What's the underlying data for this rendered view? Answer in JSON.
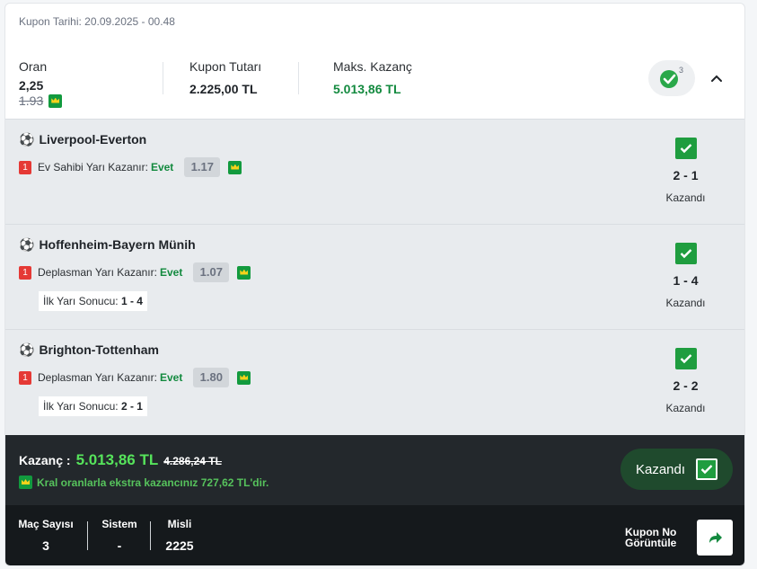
{
  "coupon": {
    "date": "Kupon Tarihi: 20.09.2025 - 00.48"
  },
  "summary": {
    "odds_label": "Oran",
    "odds_value": "2,25",
    "odds_old": "1.93",
    "stake_label": "Kupon Tutarı",
    "stake_value": "2.225,00 TL",
    "max_label": "Maks. Kazanç",
    "max_value": "5.013,86 TL",
    "badge_count": "3"
  },
  "matches": [
    {
      "name": "Liverpool-Everton",
      "rank": "1",
      "market": "Ev Sahibi Yarı Kazanır:",
      "pick": "Evet",
      "odd": "1.17",
      "score": "2 - 1",
      "status": "Kazandı"
    },
    {
      "name": "Hoffenheim-Bayern Münih",
      "rank": "1",
      "market": "Deplasman Yarı Kazanır:",
      "pick": "Evet",
      "odd": "1.07",
      "halftime_label": "İlk Yarı Sonucu:",
      "halftime_value": "1 - 4",
      "score": "1 - 4",
      "status": "Kazandı"
    },
    {
      "name": "Brighton-Tottenham",
      "rank": "1",
      "market": "Deplasman Yarı Kazanır:",
      "pick": "Evet",
      "odd": "1.80",
      "halftime_label": "İlk Yarı Sonucu:",
      "halftime_value": "2 - 1",
      "score": "2 - 2",
      "status": "Kazandı"
    }
  ],
  "footer": {
    "win_label": "Kazanç :",
    "win_amount": "5.013,86 TL",
    "win_old": "4.286,24 TL",
    "extra_text": "Kral oranlarla ekstra kazancınız 727,62 TL'dir.",
    "win_button": "Kazandı"
  },
  "stats": {
    "matches_label": "Maç Sayısı",
    "matches_value": "3",
    "system_label": "Sistem",
    "system_value": "-",
    "multiplier_label": "Misli",
    "multiplier_value": "2225",
    "coupon_view_line1": "Kupon No",
    "coupon_view_line2": "Görüntüle"
  },
  "colors": {
    "accent_green": "#138a3f",
    "win_green": "#56e35b",
    "check_green": "#1f9d3f",
    "footer_dark": "#23282c",
    "red_badge": "#e53935"
  },
  "icons": {
    "crown": "crown-icon",
    "ball": "soccer-ball-icon",
    "check": "check-icon",
    "chevron": "chevron-up-icon",
    "share": "share-arrow-icon"
  }
}
